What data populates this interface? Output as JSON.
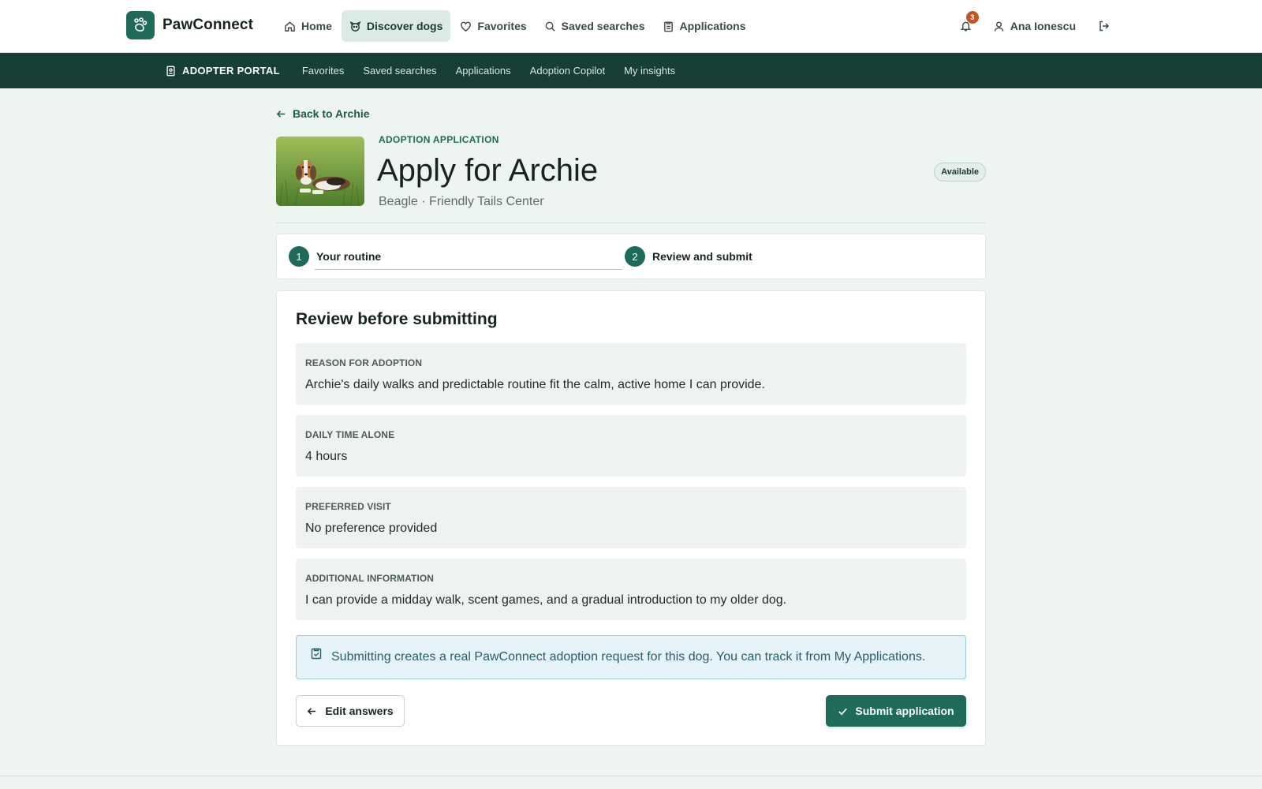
{
  "brand": {
    "name": "PawConnect"
  },
  "nav": {
    "home": "Home",
    "discover": "Discover dogs",
    "favorites": "Favorites",
    "saved_searches": "Saved searches",
    "applications": "Applications"
  },
  "header": {
    "notifications_count": "3",
    "user_name": "Ana Ionescu"
  },
  "portal": {
    "title": "ADOPTER PORTAL",
    "links": [
      "Favorites",
      "Saved searches",
      "Applications",
      "Adoption Copilot",
      "My insights"
    ]
  },
  "page": {
    "back_link": "Back to Archie",
    "eyebrow": "ADOPTION APPLICATION",
    "title": "Apply for Archie",
    "subtitle": "Beagle · Friendly Tails Center",
    "status": "Available"
  },
  "stepper": {
    "steps": [
      {
        "number": "1",
        "label": "Your routine"
      },
      {
        "number": "2",
        "label": "Review and submit"
      }
    ]
  },
  "review": {
    "title": "Review before submitting",
    "fields": [
      {
        "label": "REASON FOR ADOPTION",
        "value": "Archie's daily walks and predictable routine fit the calm, active home I can provide."
      },
      {
        "label": "DAILY TIME ALONE",
        "value": "4 hours"
      },
      {
        "label": "PREFERRED VISIT",
        "value": "No preference provided"
      },
      {
        "label": "ADDITIONAL INFORMATION",
        "value": "I can provide a midday walk, scent games, and a gradual introduction to my older dog."
      }
    ],
    "notice": "Submitting creates a real PawConnect adoption request for this dog. You can track it from My Applications.",
    "edit_label": "Edit answers",
    "submit_label": "Submit application"
  },
  "colors": {
    "brand": "#1f6b59",
    "portal_bar": "#173f36",
    "background": "#eef4ef",
    "badge": "#c0552a"
  },
  "icons": [
    "paw-icon",
    "home-icon",
    "dog-face-icon",
    "heart-icon",
    "search-icon",
    "clipboard-icon",
    "bell-icon",
    "user-icon",
    "logout-icon",
    "arrow-left-icon",
    "check-icon"
  ]
}
